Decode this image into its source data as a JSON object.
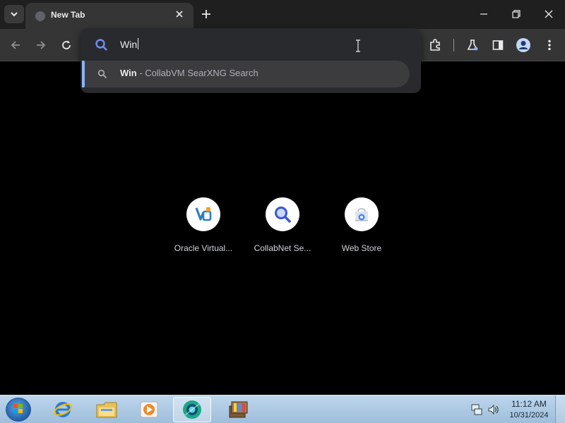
{
  "browser": {
    "tab": {
      "title": "New Tab"
    },
    "omnibox": {
      "value": "Win",
      "suggestion": {
        "match": "Win",
        "separator": " - ",
        "engine": "CollabVM SearXNG Search"
      }
    }
  },
  "shortcuts": [
    {
      "label": "Oracle Virtual...",
      "icon": "virtualbox-icon"
    },
    {
      "label": "CollabNet Se...",
      "icon": "search-magnifier-icon"
    },
    {
      "label": "Web Store",
      "icon": "web-store-icon"
    }
  ],
  "taskbar": {
    "apps": [
      "internet-explorer-icon",
      "windows-explorer-icon",
      "media-player-icon",
      "browser-icon",
      "archive-icon"
    ],
    "clock": {
      "time": "11:12 AM",
      "date": "10/31/2024"
    }
  },
  "colors": {
    "accent": "#8ab4f8",
    "toolbar": "#353535",
    "tabstrip": "#1f1f1f"
  }
}
